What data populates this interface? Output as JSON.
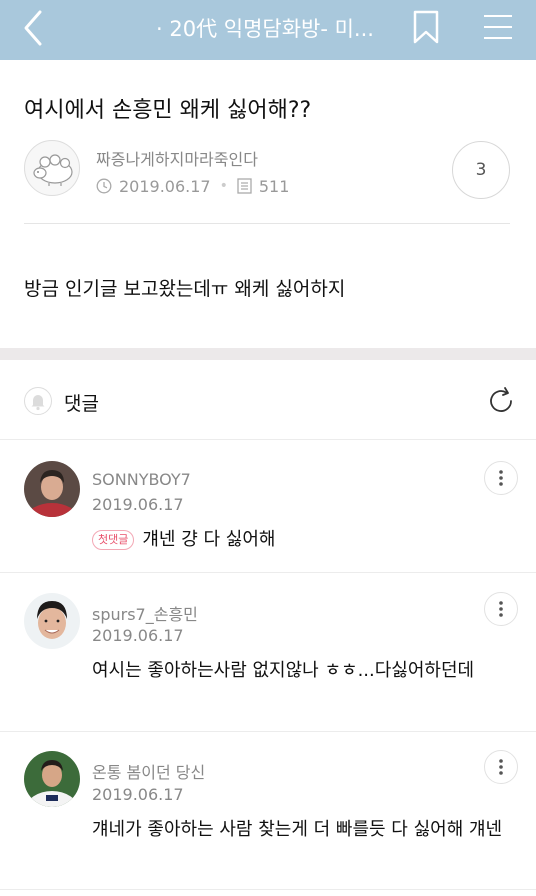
{
  "topbar": {
    "title": "· 20代 익명담화방- 미...",
    "bg_color": "#a9c8dc",
    "icons": [
      "back-arrow-icon",
      "bookmark-icon",
      "hamburger-menu-icon"
    ]
  },
  "post": {
    "title": "여시에서 손흥민 왜케 싫어해??",
    "author": "짜증나게하지마라죽인다",
    "date": "2019.06.17",
    "views": "511",
    "comment_count": "3",
    "body": "방금 인기글 보고왔는데ㅠ 왜케 싫어하지"
  },
  "comments_section": {
    "label": "댓글"
  },
  "comments": [
    {
      "name": "SONNYBOY7",
      "date": "2019.06.17",
      "badge": "첫댓글",
      "text": "걔넨 걍 다 싫어해"
    },
    {
      "name": "spurs7_손흥민",
      "date": "2019.06.17",
      "text": "여시는 좋아하는사람 없지않나 ㅎㅎ...다싫어하던데"
    },
    {
      "name": "온통 봄이던 당신",
      "date": "2019.06.17",
      "text": "걔네가 좋아하는 사람 찾는게 더 빠를듯 다 싫어해 걔넨"
    }
  ],
  "colors": {
    "accent_badge": "#e84f6a",
    "divider": "#ececec"
  }
}
